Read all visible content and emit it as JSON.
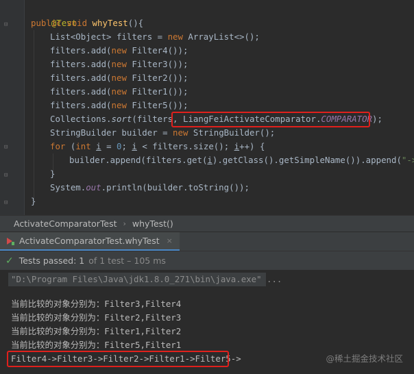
{
  "code": {
    "annotation": "@Test",
    "method_kw1": "public",
    "method_kw2": "void",
    "method_name": "whyTest",
    "method_tail": "(){",
    "line3": {
      "a": "List<Object> filters = ",
      "kw": "new",
      "b": " ArrayList<>();"
    },
    "adds": [
      {
        "a": "filters.add(",
        "kw": "new",
        "b": " Filter4());"
      },
      {
        "a": "filters.add(",
        "kw": "new",
        "b": " Filter3());"
      },
      {
        "a": "filters.add(",
        "kw": "new",
        "b": " Filter2());"
      },
      {
        "a": "filters.add(",
        "kw": "new",
        "b": " Filter1());"
      },
      {
        "a": "filters.add(",
        "kw": "new",
        "b": " Filter5());"
      }
    ],
    "sort_line": {
      "a": "Collections.",
      "sort": "sort",
      "b": "(filters, ",
      "c": "LiangFeiActivateComparator.",
      "const": "COMPARATOR",
      "d": ");"
    },
    "builder_line": {
      "a": "StringBuilder builder = ",
      "kw": "new",
      "b": " StringBuilder();"
    },
    "for_line": {
      "kw1": "for",
      "a": " (",
      "kw2": "int",
      "b": " ",
      "i1": "i",
      "c": " = ",
      "zero": "0",
      "d": "; ",
      "i2": "i",
      "e": " < filters.size(); ",
      "i3": "i",
      "f": "++) {"
    },
    "append_line": {
      "a": "builder.append(filters.get(",
      "i": "i",
      "b": ").getClass().getSimpleName()).append(",
      "str": "\"->\"",
      "c": ");"
    },
    "close_for": "}",
    "println_line": {
      "a": "System.",
      "out": "out",
      "b": ".println(builder.toString());"
    },
    "close_method": "}"
  },
  "breadcrumb": {
    "class_name": "ActivateComparatorTest",
    "separator": "›",
    "method": "whyTest()"
  },
  "run_tab": {
    "label": "ActivateComparatorTest.whyTest",
    "close": "×"
  },
  "test_status": {
    "label": "Tests passed:",
    "count": "1",
    "detail": "of 1 test – 105 ms"
  },
  "console": {
    "command": "\"D:\\Program Files\\Java\\jdk1.8.0_271\\bin\\java.exe\" ...",
    "lines": [
      "当前比较的对象分别为：Filter3,Filter4",
      "当前比较的对象分别为：Filter2,Filter3",
      "当前比较的对象分别为：Filter1,Filter2",
      "当前比较的对象分别为：Filter5,Filter1"
    ],
    "result": "Filter4->Filter3->Filter2->Filter1->Filter5->"
  },
  "watermark": "@稀土掘金技术社区",
  "colors": {
    "highlight_box": "#e0201c",
    "keyword": "#cc7832",
    "annotation": "#bbb529",
    "method": "#ffc66d",
    "string": "#6a8759",
    "number": "#6897bb",
    "static_field": "#9876aa",
    "passed_check": "#5fb060"
  }
}
